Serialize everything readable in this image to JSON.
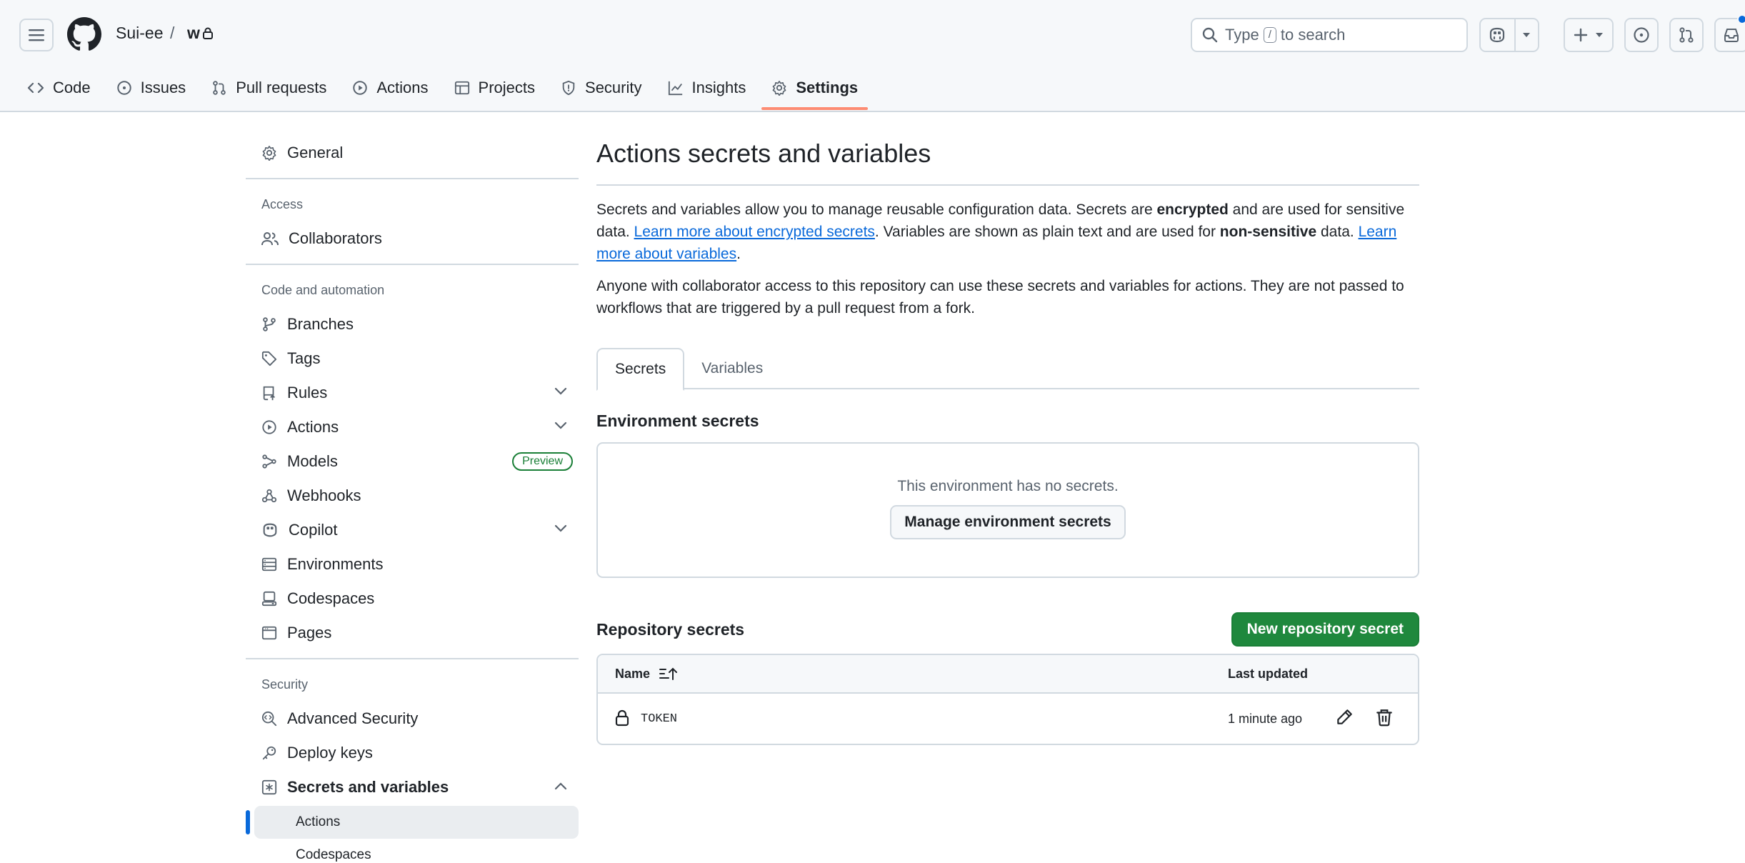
{
  "header": {
    "owner": "Sui-ee",
    "separator": "/",
    "repo": "w",
    "search_prefix": "Type",
    "search_key": "/",
    "search_suffix": "to search",
    "accent": "#0969da"
  },
  "repo_nav": {
    "tabs": [
      {
        "label": "Code",
        "icon": "code-icon"
      },
      {
        "label": "Issues",
        "icon": "issue-opened-icon"
      },
      {
        "label": "Pull requests",
        "icon": "git-pull-request-icon"
      },
      {
        "label": "Actions",
        "icon": "play-icon"
      },
      {
        "label": "Projects",
        "icon": "table-icon"
      },
      {
        "label": "Security",
        "icon": "shield-icon"
      },
      {
        "label": "Insights",
        "icon": "graph-icon"
      },
      {
        "label": "Settings",
        "icon": "gear-icon",
        "active": true
      }
    ]
  },
  "sidebar": {
    "general": "General",
    "access_heading": "Access",
    "collaborators": "Collaborators",
    "code_heading": "Code and automation",
    "branches": "Branches",
    "tags": "Tags",
    "rules": "Rules",
    "actions": "Actions",
    "models": "Models",
    "models_badge": "Preview",
    "webhooks": "Webhooks",
    "copilot": "Copilot",
    "environments": "Environments",
    "codespaces": "Codespaces",
    "pages": "Pages",
    "security_heading": "Security",
    "advanced_security": "Advanced Security",
    "deploy_keys": "Deploy keys",
    "secrets_and_variables": "Secrets and variables",
    "sub_actions": "Actions",
    "sub_codespaces": "Codespaces"
  },
  "main": {
    "title": "Actions secrets and variables",
    "desc_1a": "Secrets and variables allow you to manage reusable configuration data. Secrets are ",
    "desc_1b": "encrypted",
    "desc_1c": " and are used for sensitive data. ",
    "desc_1_link1": "Learn more about encrypted secrets",
    "desc_1d": ". Variables are shown as plain text and are used for ",
    "desc_1e": "non-sensitive",
    "desc_1f": " data. ",
    "desc_1_link2": "Learn more about variables",
    "desc_1g": ".",
    "desc_2": "Anyone with collaborator access to this repository can use these secrets and variables for actions. They are not passed to workflows that are triggered by a pull request from a fork.",
    "tab_secrets": "Secrets",
    "tab_variables": "Variables",
    "env_title": "Environment secrets",
    "env_empty": "This environment has no secrets.",
    "env_button": "Manage environment secrets",
    "repo_title": "Repository secrets",
    "new_button": "New repository secret",
    "col_name": "Name",
    "col_updated": "Last updated",
    "secrets": [
      {
        "name": "TOKEN",
        "updated": "1 minute ago"
      }
    ],
    "primary_color": "#1f883d"
  }
}
